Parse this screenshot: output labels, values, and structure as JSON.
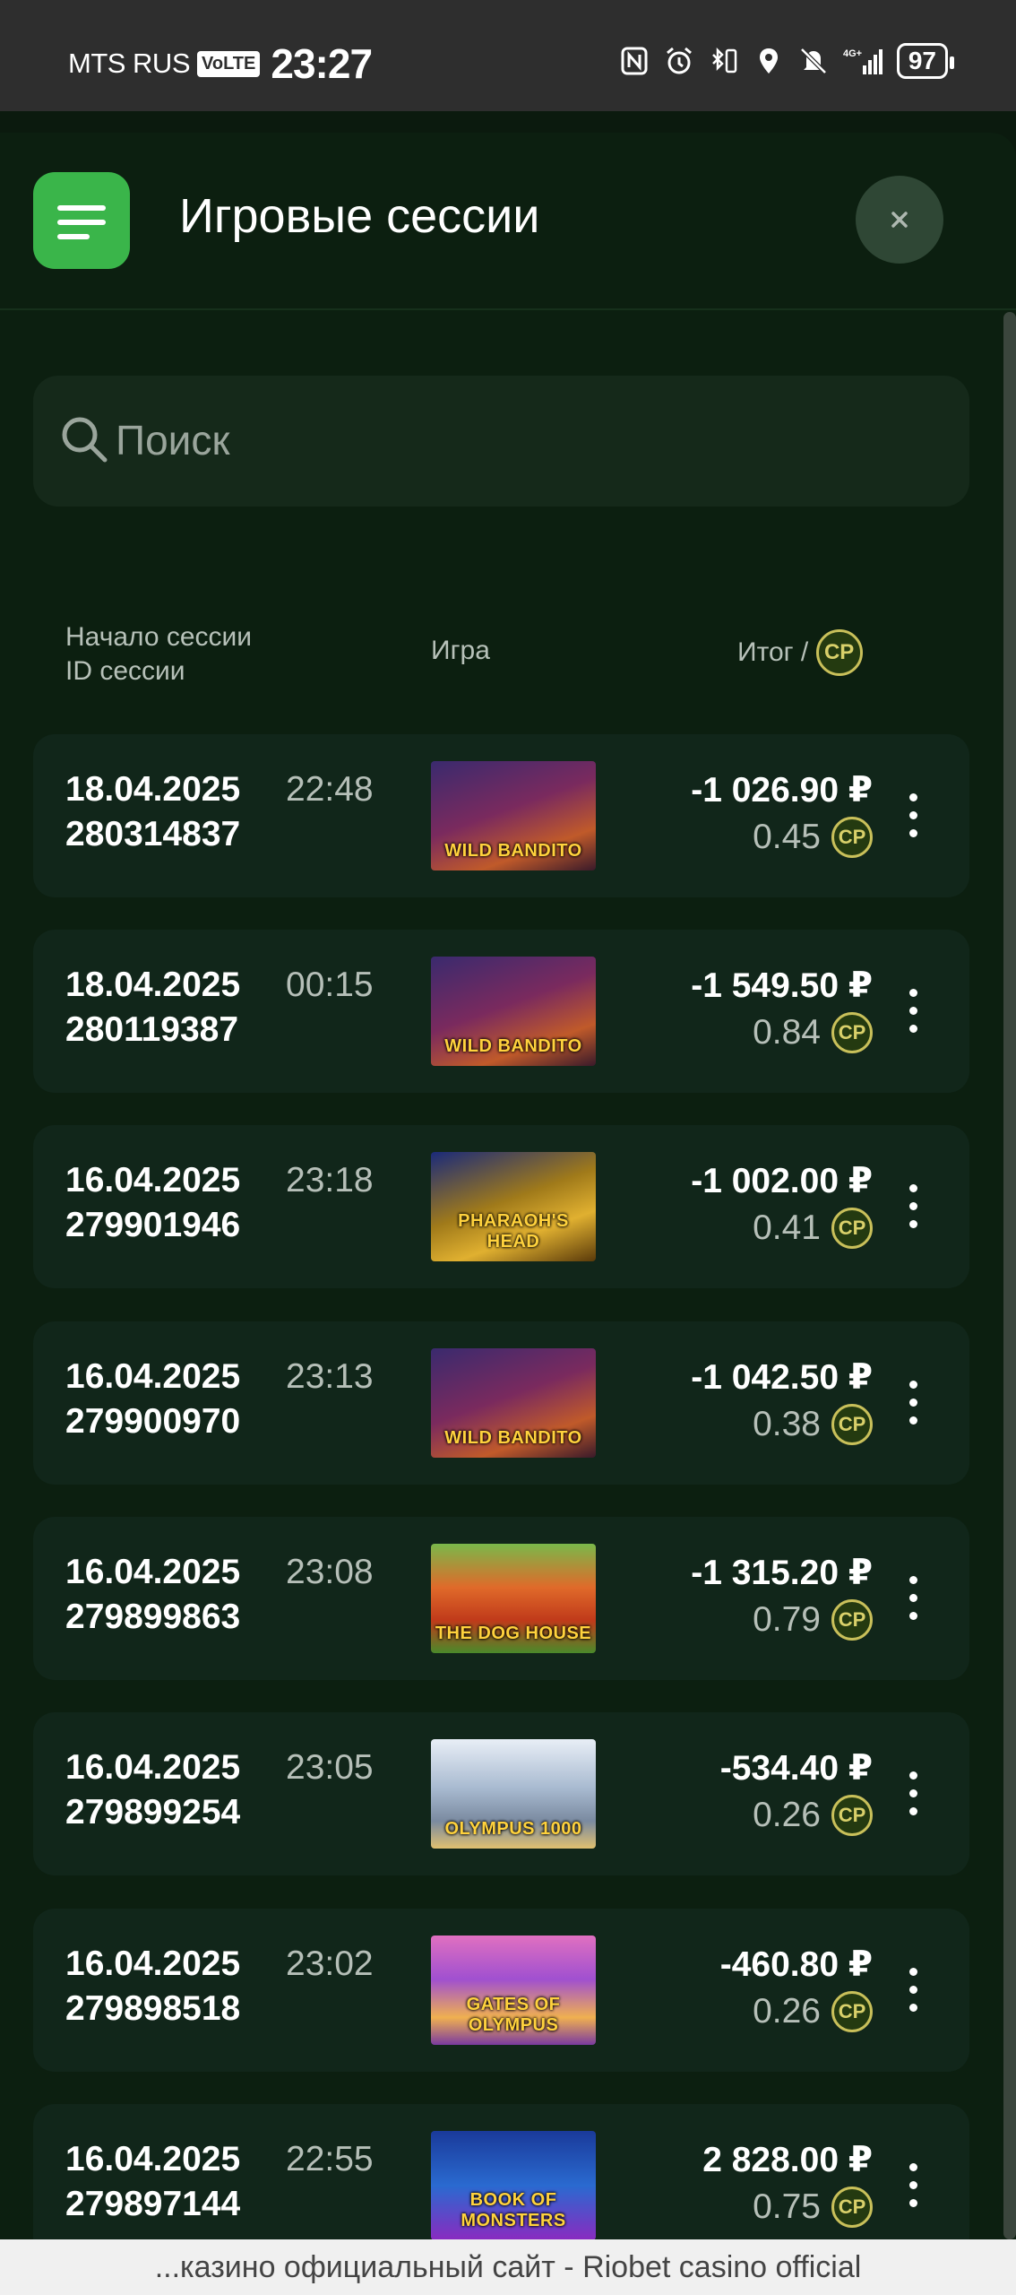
{
  "status_bar": {
    "carrier": "MTS RUS",
    "volte": "VoLTE",
    "time": "23:27",
    "battery": "97",
    "network": "4G+"
  },
  "header": {
    "title": "Игровые сессии"
  },
  "search": {
    "placeholder": "Поиск"
  },
  "columns": {
    "start_line1": "Начало сессии",
    "start_line2": "ID сессии",
    "game": "Игра",
    "total": "Итог /",
    "cp": "CP"
  },
  "sessions": [
    {
      "date": "18.04.2025",
      "time": "22:48",
      "id": "280314837",
      "game": "WILD BANDITO",
      "amount": "-1 026.90 ₽",
      "cp": "0.45"
    },
    {
      "date": "18.04.2025",
      "time": "00:15",
      "id": "280119387",
      "game": "WILD BANDITO",
      "amount": "-1 549.50 ₽",
      "cp": "0.84"
    },
    {
      "date": "16.04.2025",
      "time": "23:18",
      "id": "279901946",
      "game": "PHARAOH'S HEAD",
      "amount": "-1 002.00 ₽",
      "cp": "0.41"
    },
    {
      "date": "16.04.2025",
      "time": "23:13",
      "id": "279900970",
      "game": "WILD BANDITO",
      "amount": "-1 042.50 ₽",
      "cp": "0.38"
    },
    {
      "date": "16.04.2025",
      "time": "23:08",
      "id": "279899863",
      "game": "THE DOG HOUSE",
      "amount": "-1 315.20 ₽",
      "cp": "0.79"
    },
    {
      "date": "16.04.2025",
      "time": "23:05",
      "id": "279899254",
      "game": "OLYMPUS 1000",
      "amount": "-534.40 ₽",
      "cp": "0.26"
    },
    {
      "date": "16.04.2025",
      "time": "23:02",
      "id": "279898518",
      "game": "GATES OF OLYMPUS",
      "amount": "-460.80 ₽",
      "cp": "0.26"
    },
    {
      "date": "16.04.2025",
      "time": "22:55",
      "id": "279897144",
      "game": "BOOK OF MONSTERS",
      "amount": "2 828.00 ₽",
      "cp": "0.75"
    }
  ],
  "banner": {
    "text": "...казино официальный сайт - Riobet casino official"
  },
  "colors": {
    "accent": "#3ab54a",
    "background": "#0c1f10",
    "row": "#11261a",
    "cp_badge": "#c9c05a"
  },
  "icons": [
    "menu-icon",
    "close-icon",
    "search-icon",
    "kebab-menu-icon",
    "cp-coin-icon"
  ]
}
